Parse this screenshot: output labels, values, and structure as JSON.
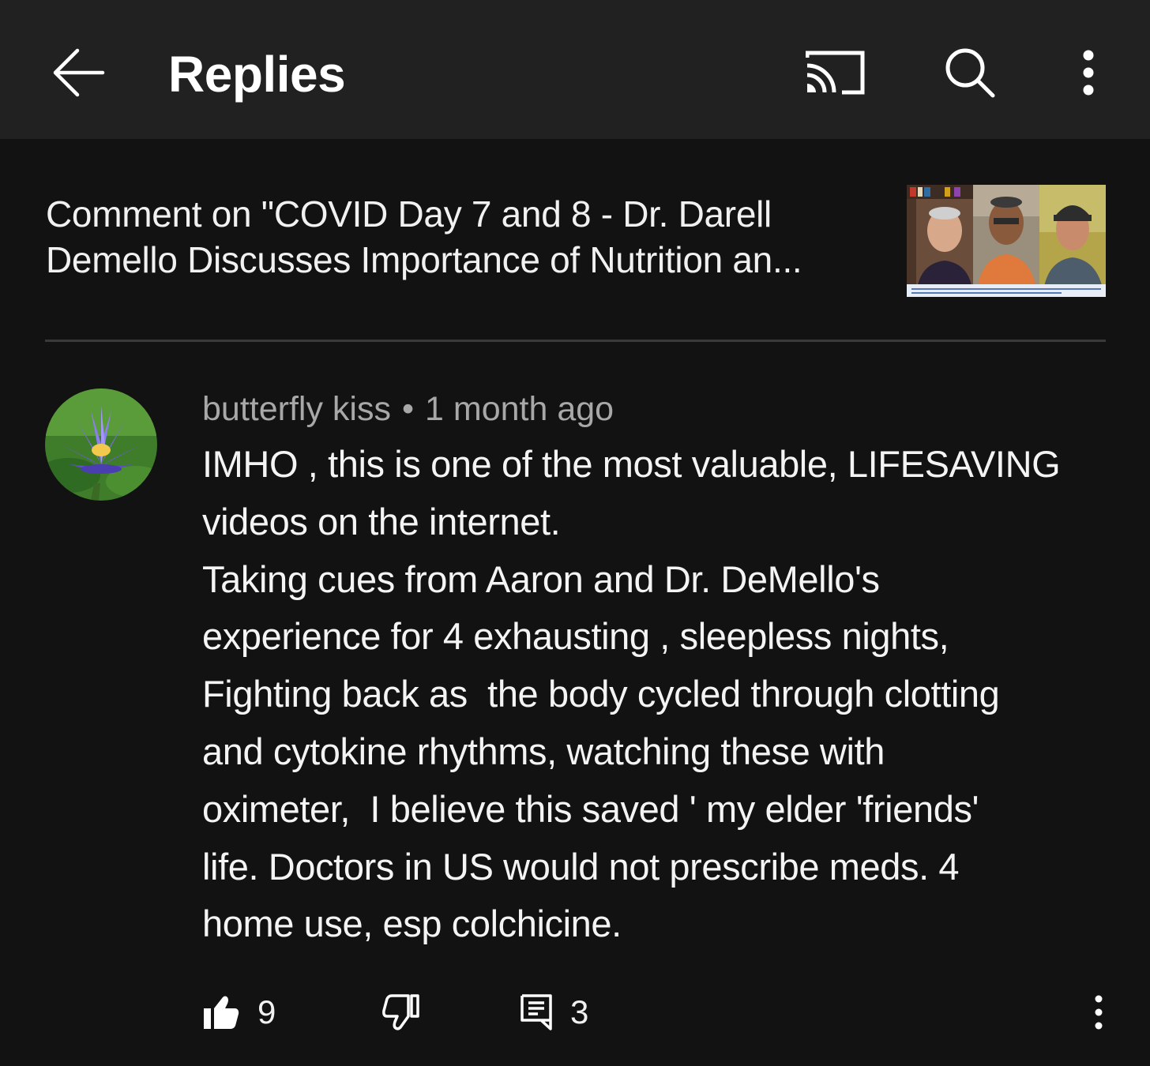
{
  "app_bar": {
    "title": "Replies",
    "icons": [
      "back-arrow-icon",
      "cast-icon",
      "search-icon",
      "more-vert-icon"
    ]
  },
  "context": {
    "line1": "Comment on \"COVID Day 7 and 8 - Dr. Darell",
    "line2": "Demello Discusses Importance of Nutrition an..."
  },
  "comment": {
    "author": "butterfly kiss",
    "separator": "•",
    "time": "1 month ago",
    "lines": [
      "IMHO , this is one of the most valuable, LIFESAVING",
      "videos on the internet.",
      "Taking cues from Aaron and Dr. DeMello's",
      "experience for 4 exhausting , sleepless nights,",
      "Fighting back as  the body cycled through clotting",
      "and cytokine rhythms, watching these with",
      "oximeter,  I believe this saved ' my elder 'friends'",
      "life. Doctors in US would not prescribe meds. 4",
      "home use, esp colchicine."
    ],
    "likes": "9",
    "replies": "3"
  },
  "colors": {
    "background": "#121212",
    "app_bar": "#212121",
    "text": "#f1f1f1",
    "secondary_text": "#a8a8a8",
    "divider": "#3a3a3a"
  }
}
